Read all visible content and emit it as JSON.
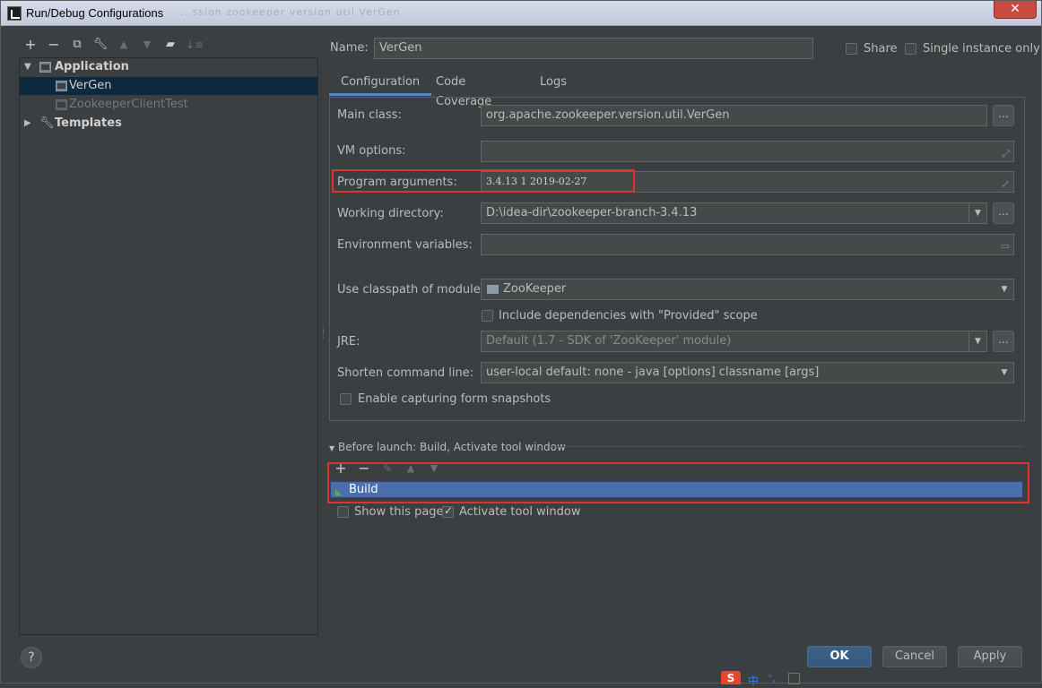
{
  "window": {
    "title": "Run/Debug Configurations",
    "title_bg_text": "...ssion  zookeeper  version  util  VerGen",
    "close_glyph": "✕"
  },
  "toolbar": {
    "icons": [
      "add-icon",
      "remove-icon",
      "copy-icon",
      "wrench-icon",
      "move-up-icon",
      "move-down-icon",
      "folder-icon",
      "sort-icon"
    ]
  },
  "tree": {
    "application_label": "Application",
    "items": [
      {
        "label": "VerGen"
      },
      {
        "label": "ZookeeperClientTest"
      }
    ],
    "templates_label": "Templates"
  },
  "form": {
    "name_label": "Name:",
    "name_value": "VerGen",
    "share_label": "Share",
    "single_instance_label": "Single instance only",
    "tabs": [
      {
        "label": "Configuration"
      },
      {
        "label": "Code Coverage"
      },
      {
        "label": "Logs"
      }
    ],
    "main_class_label": "Main class:",
    "main_class_value": "org.apache.zookeeper.version.util.VerGen",
    "vm_options_label": "VM options:",
    "vm_options_value": "",
    "program_args_label": "Program arguments:",
    "program_args_value": "3.4.13 1 2019-02-27",
    "working_dir_label": "Working directory:",
    "working_dir_value": "D:\\idea-dir\\zookeeper-branch-3.4.13",
    "env_vars_label": "Environment variables:",
    "env_vars_value": "",
    "classpath_label": "Use classpath of module:",
    "classpath_value": "ZooKeeper",
    "include_deps_label": "Include dependencies with \"Provided\" scope",
    "jre_label": "JRE:",
    "jre_value": "Default (1.7 - SDK of 'ZooKeeper' module)",
    "shorten_label": "Shorten command line:",
    "shorten_value": "user-local default: none - java [options] classname [args]",
    "snapshots_label": "Enable capturing form snapshots"
  },
  "before_launch": {
    "header": "Before launch: Build, Activate tool window",
    "items": [
      {
        "label": "Build"
      }
    ],
    "show_page_label": "Show this page",
    "activate_label": "Activate tool window",
    "show_page_checked": false,
    "activate_checked": true
  },
  "buttons": {
    "ok": "OK",
    "cancel": "Cancel",
    "apply": "Apply",
    "help": "?"
  },
  "ime": {
    "s": "S",
    "zh": "中",
    "dot": "°,"
  },
  "colors": {
    "bg": "#3c3f41",
    "selection": "#0d293e",
    "list_selection": "#4b6eaf",
    "highlight_box": "#e0322e",
    "tab_underline": "#4a88c7"
  }
}
